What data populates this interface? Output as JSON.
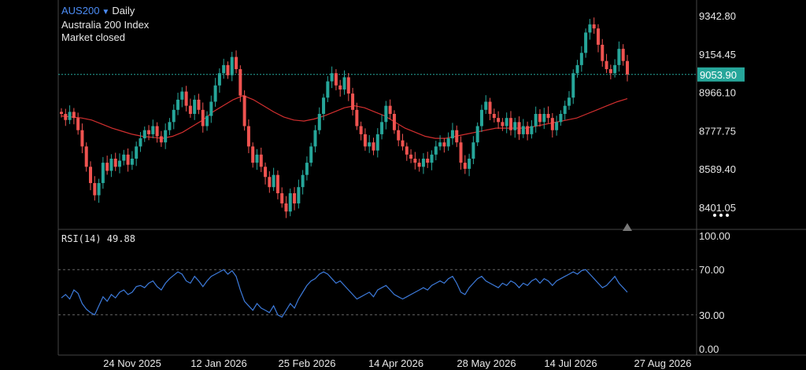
{
  "header": {
    "symbol": "AUS200",
    "interval": "Daily",
    "name": "Australia 200 Index",
    "status": "Market closed"
  },
  "price_axis": {
    "ticks": [
      "9342.80",
      "9154.45",
      "8966.10",
      "8777.75",
      "8589.40",
      "8401.05"
    ],
    "last_price": "9053.90"
  },
  "rsi_axis": {
    "label": "RSI(14) 49.88",
    "ticks": [
      "100.00",
      "70.00",
      "30.00",
      "0.00"
    ]
  },
  "time_axis": {
    "labels": [
      "24 Nov 2025",
      "12 Jan 2026",
      "25 Feb 2026",
      "14 Apr 2026",
      "28 May 2026",
      "14 Jul 2026",
      "27 Aug 2026"
    ]
  },
  "colors": {
    "up": "#26a69a",
    "down": "#ef5350",
    "ma": "#d32f2f",
    "rsi": "#3d7bdc",
    "price_line": "#26a69a"
  },
  "chart_data": [
    {
      "type": "candlestick",
      "title": "AUS200 Daily",
      "ylim": [
        8300,
        9420
      ],
      "ma_line": [
        8850,
        8845,
        8840,
        8830,
        8810,
        8790,
        8775,
        8760,
        8750,
        8745,
        8740,
        8750,
        8770,
        8800,
        8830,
        8870,
        8900,
        8930,
        8950,
        8930,
        8900,
        8870,
        8845,
        8830,
        8825,
        8835,
        8850,
        8870,
        8890,
        8900,
        8890,
        8870,
        8850,
        8820,
        8790,
        8770,
        8750,
        8740,
        8740,
        8750,
        8760,
        8770,
        8780,
        8790,
        8790,
        8790,
        8790,
        8800,
        8810,
        8820,
        8830,
        8840,
        8860,
        8880,
        8900,
        8920,
        8935
      ],
      "close": [
        8860,
        8830,
        8870,
        8840,
        8780,
        8700,
        8600,
        8520,
        8460,
        8520,
        8620,
        8580,
        8640,
        8600,
        8630,
        8660,
        8610,
        8640,
        8700,
        8740,
        8780,
        8760,
        8800,
        8750,
        8720,
        8780,
        8820,
        8880,
        8930,
        8970,
        8900,
        8860,
        8930,
        8880,
        8800,
        8850,
        8920,
        9000,
        9060,
        9100,
        9050,
        9140,
        9080,
        8950,
        8800,
        8700,
        8620,
        8660,
        8600,
        8550,
        8500,
        8560,
        8470,
        8420,
        8380,
        8470,
        8420,
        8500,
        8560,
        8620,
        8700,
        8780,
        8860,
        8940,
        9020,
        9060,
        9000,
        8980,
        9040,
        8960,
        8880,
        8800,
        8760,
        8700,
        8720,
        8680,
        8760,
        8820,
        8900,
        8860,
        8780,
        8730,
        8700,
        8660,
        8640,
        8620,
        8600,
        8640,
        8620,
        8660,
        8700,
        8720,
        8700,
        8740,
        8780,
        8720,
        8620,
        8590,
        8640,
        8720,
        8800,
        8880,
        8920,
        8860,
        8840,
        8820,
        8800,
        8840,
        8780,
        8820,
        8760,
        8800,
        8760,
        8800,
        8860,
        8820,
        8860,
        8840,
        8780,
        8820,
        8860,
        8900,
        8940,
        9060,
        9100,
        9160,
        9260,
        9300,
        9280,
        9200,
        9120,
        9080,
        9060,
        9100,
        9180,
        9120,
        9054
      ]
    },
    {
      "type": "line",
      "title": "RSI(14)",
      "ylim": [
        0,
        100
      ],
      "reference_lines": [
        70,
        30
      ],
      "values": [
        45,
        48,
        44,
        52,
        49,
        40,
        35,
        32,
        30,
        38,
        46,
        42,
        48,
        45,
        50,
        52,
        48,
        50,
        55,
        56,
        54,
        58,
        60,
        55,
        52,
        58,
        62,
        65,
        68,
        66,
        60,
        58,
        64,
        60,
        55,
        60,
        64,
        66,
        68,
        70,
        66,
        69,
        64,
        52,
        42,
        38,
        34,
        40,
        36,
        34,
        32,
        38,
        30,
        28,
        34,
        40,
        36,
        44,
        50,
        56,
        60,
        62,
        66,
        68,
        66,
        62,
        58,
        60,
        56,
        52,
        48,
        44,
        46,
        48,
        50,
        46,
        52,
        54,
        56,
        52,
        48,
        46,
        44,
        46,
        48,
        50,
        52,
        54,
        52,
        56,
        58,
        60,
        58,
        62,
        64,
        58,
        50,
        48,
        54,
        58,
        62,
        64,
        60,
        58,
        56,
        54,
        58,
        56,
        60,
        58,
        54,
        58,
        56,
        60,
        62,
        58,
        62,
        60,
        56,
        60,
        62,
        64,
        66,
        68,
        66,
        69,
        70,
        66,
        62,
        58,
        54,
        56,
        60,
        64,
        58,
        54,
        50
      ]
    }
  ]
}
